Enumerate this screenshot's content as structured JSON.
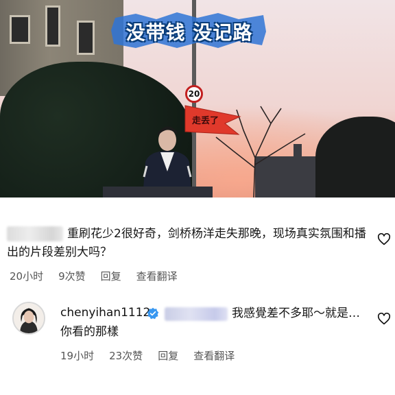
{
  "video": {
    "title_overlay": "没带钱 没记路",
    "speed_sign": "20",
    "flag_text": "走丢了"
  },
  "comments": [
    {
      "author_redacted": true,
      "text": "重刷花少2很好奇，剑桥杨洋走失那晚，现场真实氛围和播出的片段差别大吗？",
      "time": "20小时",
      "likes": "9次赞",
      "reply": "回复",
      "translate": "查看翻译",
      "heart_icon": "heart-outline-icon"
    },
    {
      "author": "chenyihan1112",
      "verified_icon": "verified-badge-icon",
      "mention_redacted": true,
      "text": "我感覺差不多耶～就是…你看的那樣",
      "time": "19小时",
      "likes": "23次赞",
      "reply": "回复",
      "translate": "查看翻译",
      "heart_icon": "heart-outline-icon",
      "accent": "#3897f0"
    }
  ]
}
